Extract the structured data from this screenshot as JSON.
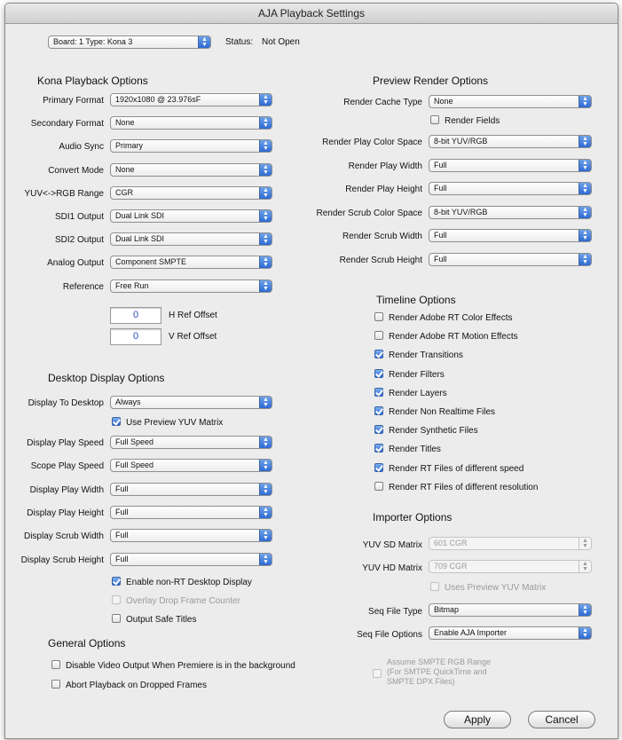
{
  "window": {
    "title": "AJA Playback Settings"
  },
  "top": {
    "board_select": "Board: 1 Type: Kona 3",
    "status_label": "Status:",
    "status_value": "Not Open"
  },
  "kona": {
    "title": "Kona Playback Options",
    "rows": [
      {
        "label": "Primary Format",
        "value": "1920x1080 @ 23.976sF"
      },
      {
        "label": "Secondary Format",
        "value": "None"
      },
      {
        "label": "Audio Sync",
        "value": "Primary"
      },
      {
        "label": "Convert Mode",
        "value": "None"
      },
      {
        "label": "YUV<->RGB Range",
        "value": "CGR"
      },
      {
        "label": "SDI1 Output",
        "value": "Dual Link SDI"
      },
      {
        "label": "SDI2 Output",
        "value": "Dual Link SDI"
      },
      {
        "label": "Analog Output",
        "value": "Component SMPTE"
      },
      {
        "label": "Reference",
        "value": "Free Run"
      }
    ],
    "h_ref_value": "0",
    "h_ref_label": "H Ref Offset",
    "v_ref_value": "0",
    "v_ref_label": "V Ref Offset"
  },
  "desktop": {
    "title": "Desktop Display Options",
    "display_to_desktop": {
      "label": "Display To Desktop",
      "value": "Always"
    },
    "use_preview_yuv": {
      "label": "Use Preview YUV Matrix",
      "checked": true
    },
    "rows": [
      {
        "label": "Display Play Speed",
        "value": "Full Speed"
      },
      {
        "label": "Scope Play Speed",
        "value": "Full Speed"
      },
      {
        "label": "Display Play Width",
        "value": "Full"
      },
      {
        "label": "Display Play Height",
        "value": "Full"
      },
      {
        "label": "Display Scrub Width",
        "value": "Full"
      },
      {
        "label": "Display Scrub Height",
        "value": "Full"
      }
    ],
    "checks": [
      {
        "label": "Enable non-RT Desktop Display",
        "checked": true,
        "disabled": false
      },
      {
        "label": "Overlay Drop Frame Counter",
        "checked": false,
        "disabled": true
      },
      {
        "label": "Output Safe Titles",
        "checked": false,
        "disabled": false
      }
    ]
  },
  "general": {
    "title": "General Options",
    "checks": [
      {
        "label": "Disable Video Output When Premiere is in the background",
        "checked": false
      },
      {
        "label": "Abort Playback on Dropped Frames",
        "checked": false
      }
    ]
  },
  "preview": {
    "title": "Preview Render Options",
    "cache": {
      "label": "Render Cache Type",
      "value": "None"
    },
    "render_fields": {
      "label": "Render Fields",
      "checked": false
    },
    "rows": [
      {
        "label": "Render Play Color Space",
        "value": "8-bit YUV/RGB"
      },
      {
        "label": "Render Play Width",
        "value": "Full"
      },
      {
        "label": "Render Play Height",
        "value": "Full"
      },
      {
        "label": "Render Scrub Color Space",
        "value": "8-bit YUV/RGB"
      },
      {
        "label": "Render Scrub Width",
        "value": "Full"
      },
      {
        "label": "Render Scrub Height",
        "value": "Full"
      }
    ]
  },
  "timeline": {
    "title": "Timeline Options",
    "checks": [
      {
        "label": "Render Adobe RT Color Effects",
        "checked": false
      },
      {
        "label": "Render Adobe RT Motion Effects",
        "checked": false
      },
      {
        "label": "Render Transitions",
        "checked": true
      },
      {
        "label": "Render Filters",
        "checked": true
      },
      {
        "label": "Render Layers",
        "checked": true
      },
      {
        "label": "Render Non Realtime Files",
        "checked": true
      },
      {
        "label": "Render Synthetic Files",
        "checked": true
      },
      {
        "label": "Render Titles",
        "checked": true
      },
      {
        "label": "Render RT Files of different speed",
        "checked": true
      },
      {
        "label": "Render RT Files of different resolution",
        "checked": false
      }
    ]
  },
  "importer": {
    "title": "Importer Options",
    "yuv_sd": {
      "label": "YUV SD Matrix",
      "value": "601 CGR"
    },
    "yuv_hd": {
      "label": "YUV HD Matrix",
      "value": "709 CGR"
    },
    "uses_preview": {
      "label": "Uses Preview YUV Matrix",
      "checked": false
    },
    "seq_type": {
      "label": "Seq File Type",
      "value": "Bitmap"
    },
    "seq_options": {
      "label": "Seq File Options",
      "value": "Enable AJA Importer"
    },
    "assume": {
      "line1": "Assume SMPTE RGB Range",
      "line2": "(For SMTPE QuickTime and",
      "line3": "SMPTE DPX Files)"
    }
  },
  "buttons": {
    "apply": "Apply",
    "cancel": "Cancel"
  },
  "colors": {
    "accent": "#2d6ad3",
    "window_bg": "#ececec",
    "field_text": "#2a4fb8"
  },
  "icons": {
    "popup_arrows": "up-down-arrows-icon",
    "check": "checkmark-icon"
  }
}
